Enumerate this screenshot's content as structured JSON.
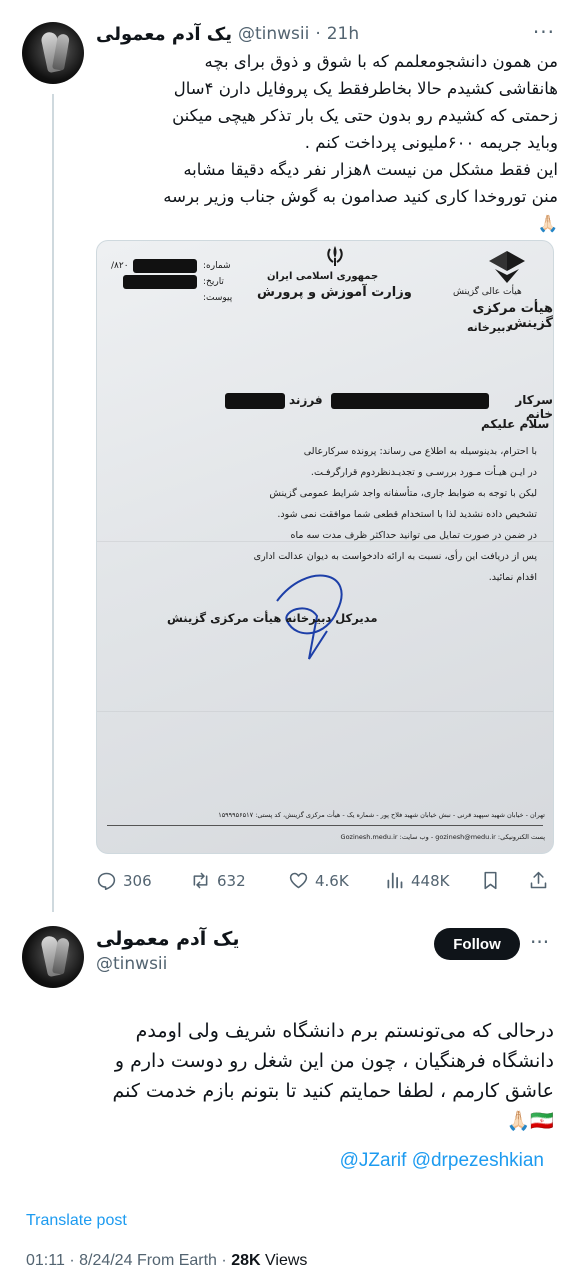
{
  "tweet1": {
    "author_name": "یک آدم معمولی",
    "handle": "@tinwsii",
    "time": "21h",
    "separator": "·",
    "more": "···",
    "text_lines": [
      "من همون دانشجومعلمم که با شوق و ذوق برای بچه",
      "هانقاشی کشیدم حالا بخاطرفقط یک پروفایل دارن ۴سال",
      "زحمتی که کشیدم رو بدون حتی یک بار تذکر هیچی میکنن",
      "وباید جریمه ۶۰۰ملیونی پرداخت کنم .",
      " این فقط مشکل من نیست ۸هزار نفر دیگه دقیقا مشابه",
      "منن توروخدا کاری کنید صدامون به گوش جناب وزیر برسه",
      "🙏🏻"
    ],
    "document": {
      "ministry_top": "جمهوری اسلامی ایران",
      "ministry_name": "وزارت آموزش و پرورش",
      "org_small": "هیأت عالی گزینش",
      "org_main": "هیأت مرکزی گزینش",
      "org_sub": "دبیرخانه",
      "field_number": "شماره:",
      "field_date": "تاریخ:",
      "field_attach": "پیوست:",
      "number_prefix": "۸۲۰/",
      "salutation": "سرکار خانم",
      "child_of": "فرزند",
      "greeting": "سلام علیکم",
      "body_lines": [
        "با احترام، بدینوسیله به اطلاع می رساند: پرونده سرکارعالی",
        "در ایـن هیـأت مـورد بررسـی و تجدیـدنظردوم قرارگرفـت.",
        "لیکن با توجه به ضوابط جاری، متأسفانه واجد شرایط عمومی گزینش",
        "تشخیص داده نشدید لذا با استخدام قطعی شما موافقت نمی شود.",
        "در ضمن در صورت تمایل می توانید حداکثر ظرف مدت سه ماه",
        "پس از دریافت این رأی، نسبت به ارائه دادخواست به دیوان عدالت اداری",
        "اقدام نمائید."
      ],
      "signature": "مدیرکل دبیرخانه هیأت مرکزی گزینش",
      "footer_address": "تهران - خیابان شهید سپهبد قرنی - نبش خیابان شهید فلاح پور - شماره یک - هیأت مرکزی گزینش، کد پستی: ۱۵۹۹۹۵۶۵۱۷",
      "footer_web": "پست الکترونیکی: gozinesh@medu.ir - وب سایت: Gozinesh.medu.ir"
    },
    "actions": {
      "replies": "306",
      "reposts": "632",
      "likes": "4.6K",
      "views": "448K"
    }
  },
  "tweet2": {
    "author_name": "یک آدم معمولی",
    "handle": "@tinwsii",
    "follow_label": "Follow",
    "more": "···",
    "text_lines": [
      "درحالی که می‌تونستم برم دانشگاه شریف ولی اومدم",
      "دانشگاه فرهنگیان ، چون من این شغل رو دوست دارم و",
      "عاشق کارمم ، لطفا حمایتم کنید تا بتونم بازم خدمت کنم",
      "🇮🇷🙏🏻"
    ],
    "mentions": "@JZarif @drpezeshkian",
    "translate_label": "Translate post",
    "time": "01:11",
    "date": "8/24/24",
    "source": "From Earth",
    "views_count": "28K",
    "views_label": "Views",
    "dot": "·"
  }
}
